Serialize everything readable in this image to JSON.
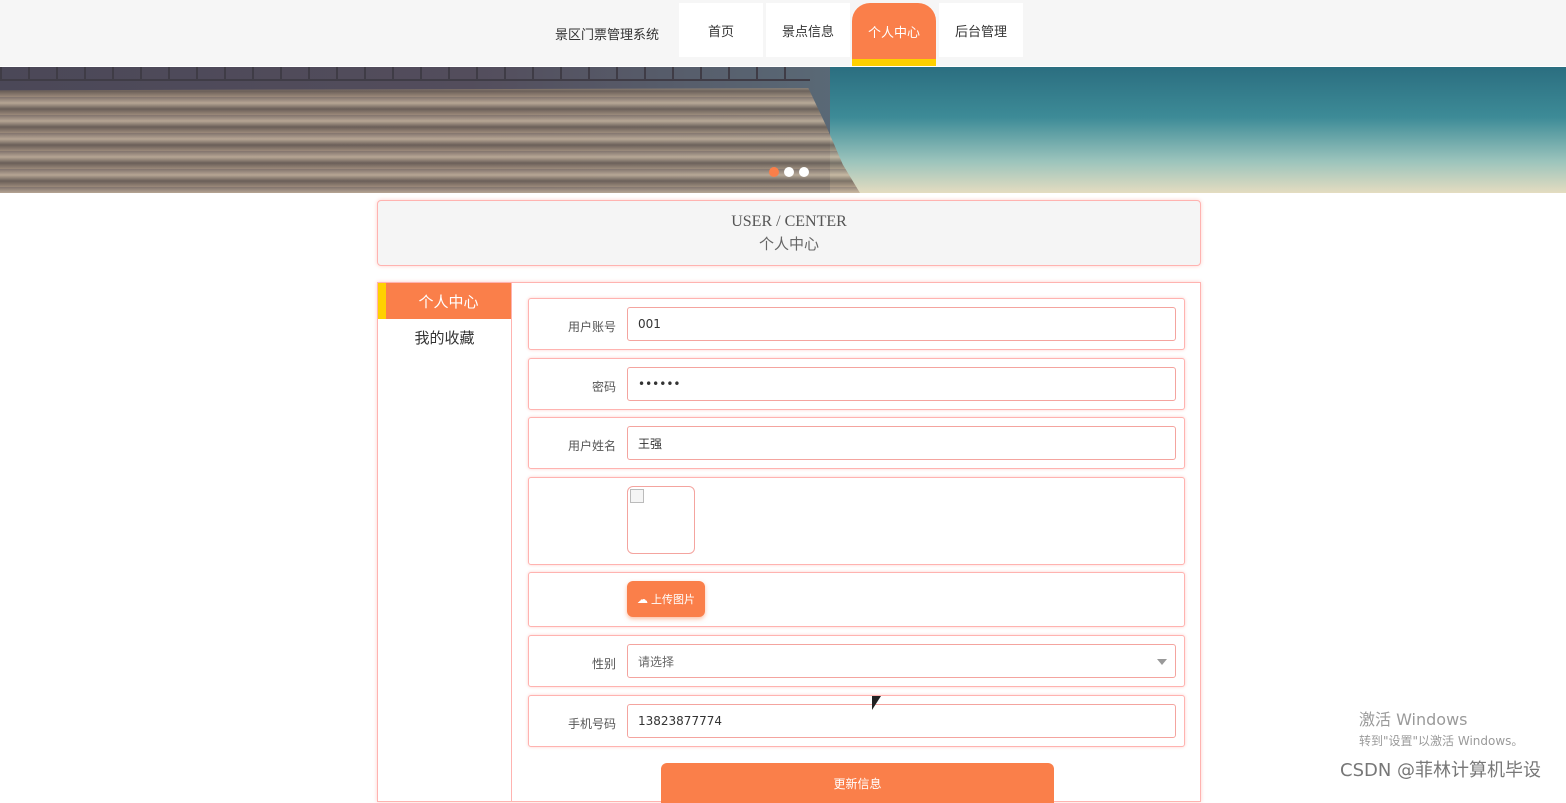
{
  "brand": "景区门票管理系统",
  "nav": [
    "首页",
    "景点信息",
    "个人中心",
    "后台管理"
  ],
  "nav_active": 2,
  "user_center": {
    "title_en": "USER / CENTER",
    "title_cn": "个人中心"
  },
  "side_menu": [
    "个人中心",
    "我的收藏"
  ],
  "form": {
    "account_label": "用户账号",
    "account_value": "001",
    "password_label": "密码",
    "password_value": "••••••",
    "name_label": "用户姓名",
    "name_value": "王强",
    "upload_label": "上传图片",
    "gender_label": "性别",
    "gender_placeholder": "请选择",
    "phone_label": "手机号码",
    "phone_value": "13823877774",
    "submit_label": "更新信息"
  },
  "watermark": {
    "line1": "激活 Windows",
    "line2": "转到\"设置\"以激活 Windows。"
  },
  "csdn": "CSDN @菲林计算机毕设",
  "colors": {
    "accent": "#fa7f4a",
    "highlight": "#ffd000",
    "border": "#ffb3b0"
  }
}
